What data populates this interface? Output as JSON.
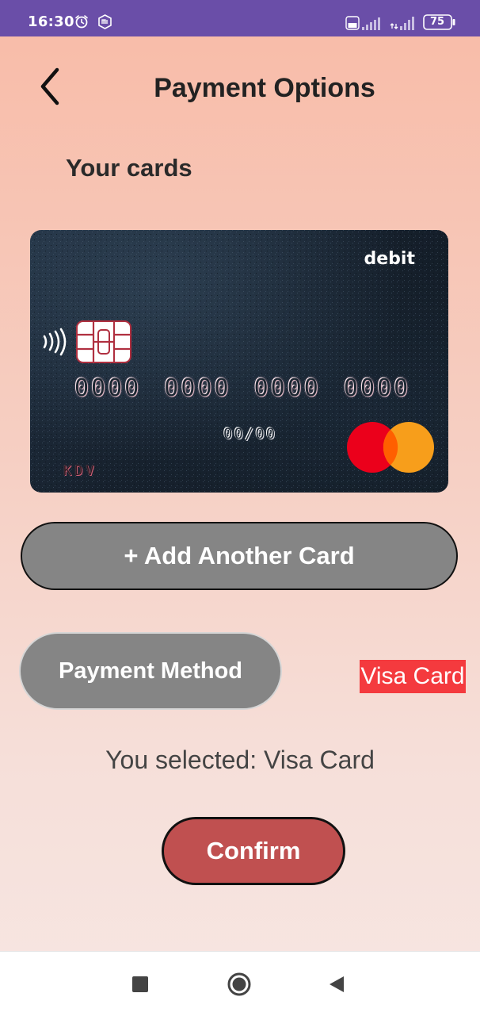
{
  "status_bar": {
    "time": "16:30",
    "battery": "75",
    "icons": [
      "alarm-icon",
      "mi-icon",
      "volte-icon",
      "signal-icon",
      "battery-icon"
    ]
  },
  "header": {
    "title": "Payment Options",
    "back_icon": "chevron-left-icon"
  },
  "cards_section": {
    "title": "Your cards"
  },
  "card": {
    "type": "debit",
    "number": "0000 0000 0000 0000",
    "expiry": "00/00",
    "holder": "KDV",
    "network_icon": "mastercard-logo"
  },
  "actions": {
    "add_card_label": "+ Add Another Card",
    "payment_method_label": "Payment Method",
    "selected_method": "Visa Card",
    "selection_text": "You selected: Visa Card",
    "confirm_label": "Confirm"
  },
  "colors": {
    "status_bar": "#6a4ea8",
    "button_gray": "#858585",
    "confirm_red": "#c05050",
    "visa_label_red": "#f43a3e"
  },
  "nav_bar": {
    "icons": [
      "recents-icon",
      "home-icon",
      "back-icon"
    ]
  }
}
